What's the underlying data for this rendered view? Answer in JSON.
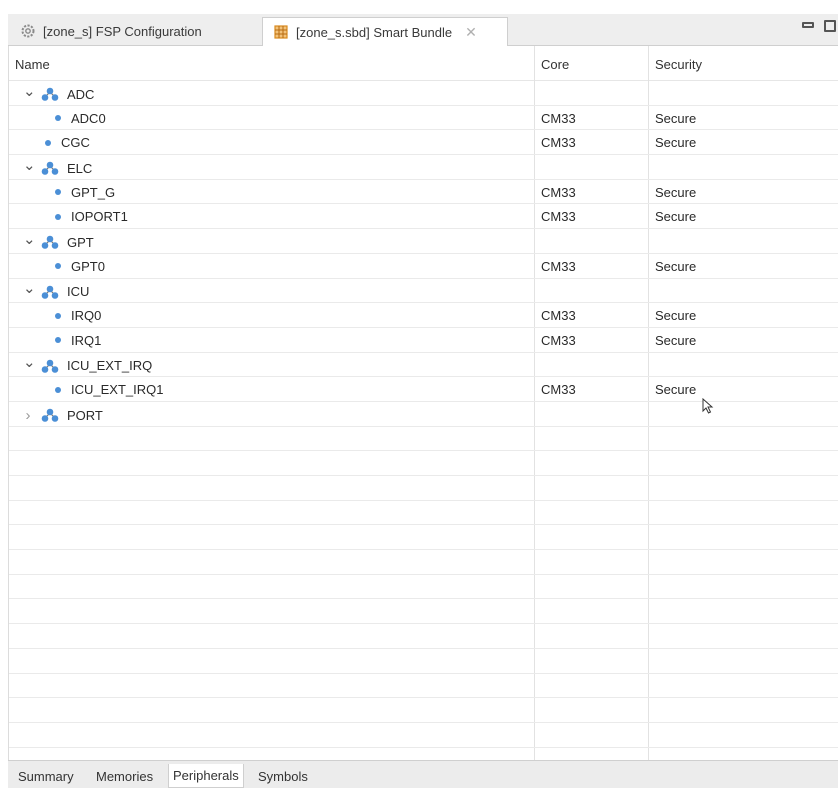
{
  "tabs": [
    {
      "label": "[zone_s] FSP Configuration",
      "icon": "gear-icon",
      "active": false
    },
    {
      "label": "[zone_s.sbd] Smart Bundle",
      "icon": "bundle-grid-icon",
      "active": true
    }
  ],
  "window_controls": {
    "minimize_icon": "minimize-icon",
    "maximize_icon": "maximize-icon"
  },
  "table": {
    "headers": {
      "name": "Name",
      "core": "Core",
      "security": "Security"
    },
    "rows": [
      {
        "kind": "group",
        "expanded": true,
        "indent": 0,
        "label": "ADC",
        "core": "",
        "security": ""
      },
      {
        "kind": "leaf",
        "indent": 1,
        "label": "ADC0",
        "core": "CM33",
        "security": "Secure"
      },
      {
        "kind": "leaf",
        "indent": 0,
        "label": "CGC",
        "core": "CM33",
        "security": "Secure"
      },
      {
        "kind": "group",
        "expanded": true,
        "indent": 0,
        "label": "ELC",
        "core": "",
        "security": ""
      },
      {
        "kind": "leaf",
        "indent": 1,
        "label": "GPT_G",
        "core": "CM33",
        "security": "Secure"
      },
      {
        "kind": "leaf",
        "indent": 1,
        "label": "IOPORT1",
        "core": "CM33",
        "security": "Secure"
      },
      {
        "kind": "group",
        "expanded": true,
        "indent": 0,
        "label": "GPT",
        "core": "",
        "security": ""
      },
      {
        "kind": "leaf",
        "indent": 1,
        "label": "GPT0",
        "core": "CM33",
        "security": "Secure"
      },
      {
        "kind": "group",
        "expanded": true,
        "indent": 0,
        "label": "ICU",
        "core": "",
        "security": ""
      },
      {
        "kind": "leaf",
        "indent": 1,
        "label": "IRQ0",
        "core": "CM33",
        "security": "Secure"
      },
      {
        "kind": "leaf",
        "indent": 1,
        "label": "IRQ1",
        "core": "CM33",
        "security": "Secure"
      },
      {
        "kind": "group",
        "expanded": true,
        "indent": 0,
        "label": "ICU_EXT_IRQ",
        "core": "",
        "security": ""
      },
      {
        "kind": "leaf",
        "indent": 1,
        "label": "ICU_EXT_IRQ1",
        "core": "CM33",
        "security": "Secure"
      },
      {
        "kind": "group",
        "expanded": false,
        "indent": 0,
        "label": "PORT",
        "core": "",
        "security": ""
      }
    ],
    "empty_row_count": 13
  },
  "bottom_tabs": [
    {
      "label": "Summary",
      "active": false
    },
    {
      "label": "Memories",
      "active": false
    },
    {
      "label": "Peripherals",
      "active": true
    },
    {
      "label": "Symbols",
      "active": false
    }
  ],
  "colors": {
    "group_icon": "#4b8fd6",
    "leaf_dot": "#4b8fd6",
    "tab_bundle_icon": "#d88a1e"
  }
}
